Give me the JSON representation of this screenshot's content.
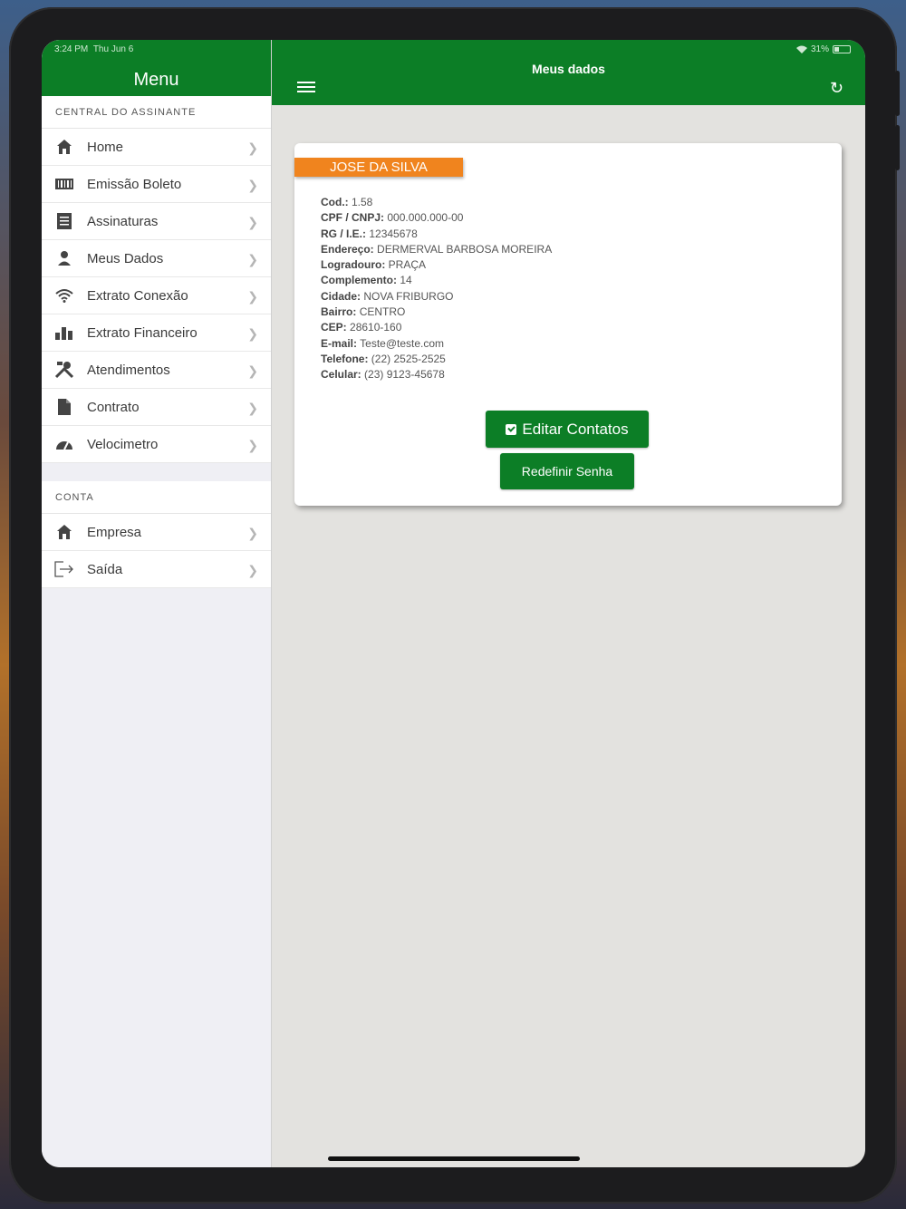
{
  "status_bar": {
    "time": "3:24 PM",
    "date": "Thu Jun 6",
    "battery": "31%"
  },
  "sidebar": {
    "title": "Menu",
    "section1_label": "CENTRAL DO ASSINANTE",
    "items": [
      {
        "label": "Home",
        "icon": "home-icon"
      },
      {
        "label": "Emissão Boleto",
        "icon": "barcode-icon"
      },
      {
        "label": "Assinaturas",
        "icon": "document-icon"
      },
      {
        "label": "Meus Dados",
        "icon": "user-icon"
      },
      {
        "label": "Extrato Conexão",
        "icon": "wifi-icon"
      },
      {
        "label": "Extrato Financeiro",
        "icon": "bar-chart-icon"
      },
      {
        "label": "Atendimentos",
        "icon": "tools-icon"
      },
      {
        "label": "Contrato",
        "icon": "file-icon"
      },
      {
        "label": "Velocimetro",
        "icon": "speedometer-icon"
      }
    ],
    "section2_label": "CONTA",
    "account_items": [
      {
        "label": "Empresa",
        "icon": "home-icon"
      },
      {
        "label": "Saída",
        "icon": "logout-icon"
      }
    ]
  },
  "header": {
    "title": "Meus dados"
  },
  "profile": {
    "name": "JOSE DA SILVA",
    "fields": [
      {
        "label": "Cod.:",
        "value": "1.58"
      },
      {
        "label": "CPF / CNPJ:",
        "value": "000.000.000-00"
      },
      {
        "label": "RG / I.E.:",
        "value": "12345678"
      },
      {
        "label": "Endereço:",
        "value": "DERMERVAL BARBOSA MOREIRA"
      },
      {
        "label": "Logradouro:",
        "value": "PRAÇA"
      },
      {
        "label": "Complemento:",
        "value": "14"
      },
      {
        "label": "Cidade:",
        "value": "NOVA FRIBURGO"
      },
      {
        "label": "Bairro:",
        "value": "CENTRO"
      },
      {
        "label": "CEP:",
        "value": "28610-160"
      },
      {
        "label": "E-mail:",
        "value": "Teste@teste.com"
      },
      {
        "label": "Telefone:",
        "value": "(22) 2525-2525"
      },
      {
        "label": "Celular:",
        "value": "(23) 9123-45678"
      }
    ],
    "edit_button": "Editar Contatos",
    "reset_button": "Redefinir Senha"
  },
  "colors": {
    "primary": "#0c7e26",
    "accent": "#f0841e",
    "background": "#e3e2df"
  }
}
